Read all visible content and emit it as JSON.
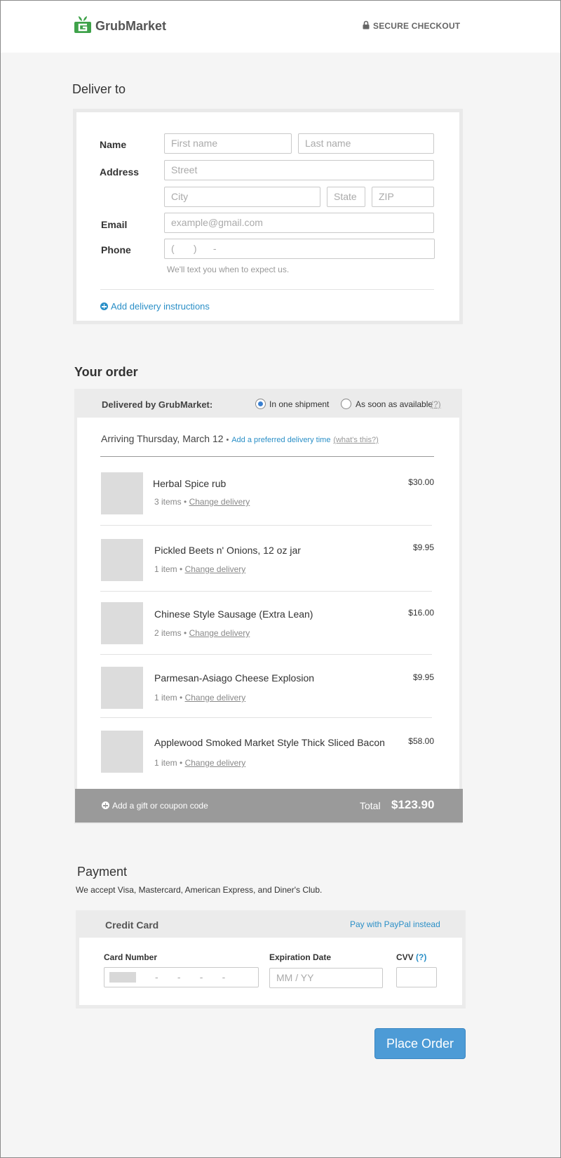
{
  "header": {
    "brand": "GrubMarket",
    "secure_label": "SECURE CHECKOUT"
  },
  "deliver": {
    "title": "Deliver to",
    "name_label": "Name",
    "first_placeholder": "First name",
    "last_placeholder": "Last name",
    "address_label": "Address",
    "street_placeholder": "Street",
    "city_placeholder": "City",
    "state_placeholder": "State",
    "zip_placeholder": "ZIP",
    "email_label": "Email",
    "email_placeholder": "example@gmail.com",
    "phone_label": "Phone",
    "phone_placeholder": "(       )      -",
    "phone_hint": "We'll text you when to expect us.",
    "instructions_link": "Add delivery instructions"
  },
  "order": {
    "title": "Your order",
    "delivered_by": "Delivered by GrubMarket:",
    "option_one": "In one shipment",
    "option_two": "As soon as available",
    "option_two_help": "(?)",
    "arriving": "Arriving Thursday, March 12",
    "bullet": "•",
    "preferred_link": "Add a preferred delivery time",
    "whats_this": "(what's this?)",
    "items": [
      {
        "name": "Herbal Spice rub",
        "count": "3 items",
        "change": "Change delivery",
        "price": "$30.00"
      },
      {
        "name": "Pickled Beets n' Onions, 12 oz jar",
        "count": "1 item",
        "change": "Change delivery",
        "price": "$9.95"
      },
      {
        "name": "Chinese Style Sausage (Extra Lean)",
        "count": "2 items",
        "change": "Change delivery",
        "price": "$16.00"
      },
      {
        "name": "Parmesan-Asiago Cheese Explosion",
        "count": "1 item",
        "change": "Change delivery",
        "price": "$9.95"
      },
      {
        "name": "Applewood Smoked Market Style Thick Sliced Bacon",
        "count": "1 item",
        "change": "Change delivery",
        "price": "$58.00"
      }
    ],
    "coupon_link": "Add a gift or coupon code",
    "total_label": "Total",
    "total_value": "$123.90"
  },
  "payment": {
    "title": "Payment",
    "accepted": "We accept Visa, Mastercard, American Express, and Diner's Club.",
    "method": "Credit Card",
    "paypal_link": "Pay with PayPal instead",
    "card_number_label": "Card Number",
    "card_placeholder": "-       -       -       -",
    "expiration_label": "Expiration Date",
    "expiration_placeholder": "MM / YY",
    "cvv_label": "CVV",
    "cvv_help": "(?)",
    "place_order": "Place Order"
  },
  "colors": {
    "brand_green": "#3fa24a",
    "link_blue": "#2a8fc7",
    "button_blue": "#4d9bd6",
    "total_bar": "#9a9a9a"
  }
}
